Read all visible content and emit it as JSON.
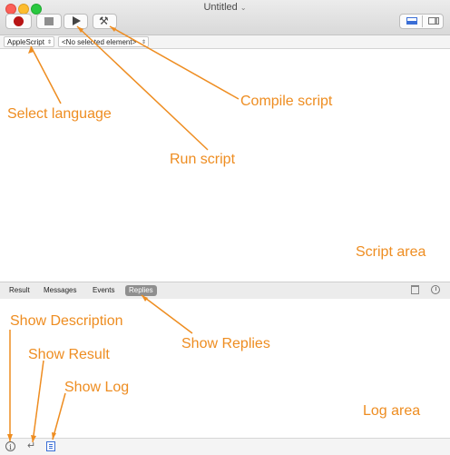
{
  "window": {
    "title": "Untitled"
  },
  "toolbar": {
    "record_icon": "record-icon",
    "stop_icon": "stop-icon",
    "run_icon": "play-icon",
    "compile_icon": "hammer-icon",
    "view_icons": [
      "bottom-pane-icon",
      "side-pane-icon"
    ]
  },
  "navbar": {
    "language": "AppleScript",
    "element": "<No selected element>"
  },
  "tabs": [
    "Result",
    "Messages",
    "Events",
    "Replies"
  ],
  "selected_tab": "Replies",
  "bottombar": {
    "icons": [
      "info-icon",
      "return-icon",
      "log-list-icon"
    ]
  },
  "annotations": {
    "select_language": "Select language",
    "compile_script": "Compile script",
    "run_script": "Run script",
    "script_area": "Script area",
    "show_replies": "Show Replies",
    "show_description": "Show Description",
    "show_result": "Show Result",
    "show_log": "Show Log",
    "log_area": "Log area"
  },
  "colors": {
    "annotation": "#ee8d21",
    "record": "#b81414",
    "accent": "#3a6ed6",
    "selected_tab": "#8f8f8f"
  }
}
